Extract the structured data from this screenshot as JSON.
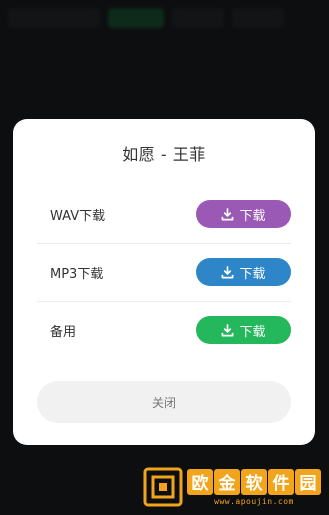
{
  "modal": {
    "title": "如愿 - 王菲",
    "rows": [
      {
        "label": "WAV下载",
        "button": "下载",
        "color": "#9b59b6"
      },
      {
        "label": "MP3下载",
        "button": "下载",
        "color": "#2e86c9"
      },
      {
        "label": "备用",
        "button": "下载",
        "color": "#25b75c"
      }
    ],
    "close_label": "关闭"
  },
  "watermark": {
    "chars": [
      "欧",
      "金",
      "软",
      "件",
      "园"
    ],
    "url": "www.apoujin.com",
    "color": "#f2a51c"
  }
}
